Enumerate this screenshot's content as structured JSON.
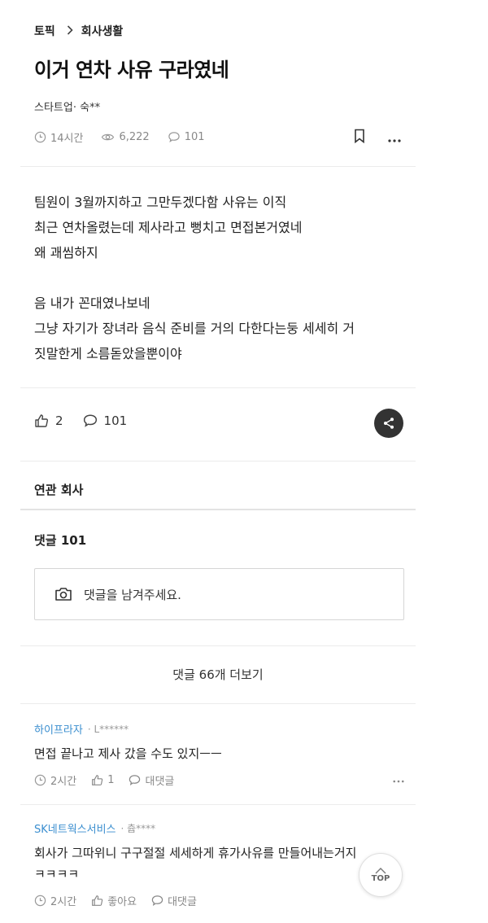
{
  "breadcrumb": {
    "root": "토픽",
    "current": "회사생활"
  },
  "post": {
    "title": "이거 연차 사유 구라였네",
    "author": "스타트업· 숙**",
    "time": "14시간",
    "views": "6,222",
    "comments": "101",
    "body": "팀원이 3월까지하고 그만두겠다함 사유는 이직\n최근 연차올렸는데 제사라고 뻥치고 면접본거였네\n왜 괘씸하지\n\n음 내가 꼰대였나보네\n그냥 자기가 장녀라 음식 준비를 거의 다한다는둥 세세히 거\n짓말한게 소름돋았을뿐이야",
    "likes": "2",
    "comment_count": "101"
  },
  "related": {
    "title": "연관 회사"
  },
  "comments_section": {
    "title": "댓글 101",
    "input_placeholder": "댓글을 남겨주세요.",
    "more_label": "댓글 66개 더보기"
  },
  "comments": [
    {
      "company": "하이프라자",
      "nick": "· L******",
      "text": "면접 끝나고 제사 갔을 수도 있지ㅡㅡ",
      "time": "2시간",
      "likes": "1",
      "reply": "대댓글"
    },
    {
      "company": "SK네트웍스서비스",
      "nick": "· 츕****",
      "text": "회사가 그따위니 구구절절 세세하게 휴가사유를 만들어내는거지\nㅋㅋㅋㅋ",
      "time": "2시간",
      "likes": "좋아요",
      "reply": "대댓글"
    }
  ],
  "top_button": "TOP"
}
